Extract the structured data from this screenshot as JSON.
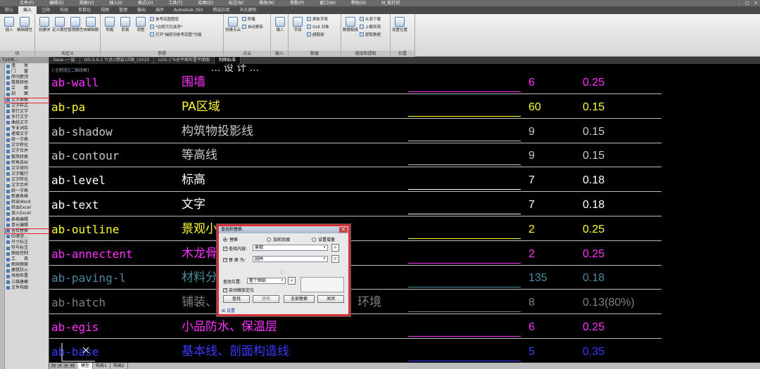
{
  "menubar": {
    "items": [
      "文件(F)",
      "编辑(E)",
      "视图(V)",
      "插入(I)",
      "格式(O)",
      "工具(T)",
      "绘图(D)",
      "标注(N)",
      "修改(M)",
      "参数(P)",
      "窗口(W)",
      "帮助(H)",
      "M_批打印"
    ]
  },
  "ribbon_tabs": {
    "items": [
      "默认",
      "插入",
      "注释",
      "布局",
      "参数化",
      "视图",
      "管理",
      "输出",
      "插件",
      "Autodesk 360",
      "精选应用",
      "天正建筑"
    ],
    "active": "插入"
  },
  "ribbon": {
    "groups": [
      {
        "title": "块",
        "buttons": [
          "插入",
          "编辑属性"
        ]
      },
      {
        "title": "块定义",
        "buttons": [
          "创建块",
          "定义属性",
          "管理属性",
          "块编辑器"
        ]
      },
      {
        "title": "参照",
        "buttons": [
          "附着",
          "剪裁",
          "调整"
        ],
        "small": [
          "参考底图图层",
          "*边框可见选项*",
          "打开\"捕捉到参考底图\"功能"
        ]
      },
      {
        "title": "点云",
        "buttons": [
          "创建点云"
        ],
        "small": [
          "附着",
          "自动更新"
        ]
      },
      {
        "title": "输入",
        "buttons": [
          "输入"
        ]
      },
      {
        "title": "数据",
        "buttons": [
          "字段"
        ],
        "small": [
          "更新字段",
          "OLE 对象",
          "超链接"
        ]
      },
      {
        "title": "链接和提取",
        "buttons": [
          "数据链接"
        ],
        "small": [
          "从源下载",
          "上载到源",
          "提取数据"
        ]
      },
      {
        "title": "位置",
        "buttons": [
          "设置位置"
        ]
      }
    ]
  },
  "sidebar": {
    "header": "T20天...",
    "items": [
      "墙　　体",
      "门　　窗",
      "房间屋顶",
      "楼梯其他",
      "立　　面",
      "剖　　面",
      "文字表格",
      "文字样式",
      "单行文字",
      "多行文字",
      "曲线文字",
      "专业词库",
      "递增文字",
      "统一字高",
      "文字转化",
      "文字合并",
      "繁简转换",
      "转角自纠",
      "文字排列",
      "文字截行",
      "文字转化",
      "文字合并",
      "统一字高",
      "新建表格",
      "转出Word",
      "转出Excel",
      "读入Excel",
      "表格编辑",
      "单元编辑",
      "查找替换",
      "ID类型...",
      "尺寸标注",
      "符号标注",
      "图层控制",
      "工　　具",
      "图块图案",
      "建筑防火",
      "场地布置",
      "三维建模",
      "文件布图"
    ],
    "highlighted": [
      "文字表格",
      "查找替换"
    ]
  },
  "doc_tabs": {
    "items": [
      "base--一层",
      "DG-5.6.1 T(总)(精装)详图_t2010",
      "LOG-1\"6总平面布置平面图",
      "制图标准"
    ],
    "active": "制图标准"
  },
  "canvas": {
    "view_label": "[-][俯视][二维线框]",
    "ghost_heading": "... 设 计 ..."
  },
  "layers": [
    {
      "name": "ab-wall",
      "desc": "围墙",
      "color": "6",
      "lineweight": "0.25",
      "text_color": "#ff33ff"
    },
    {
      "name": "ab-pa",
      "desc": "PA区域",
      "color": "60",
      "lineweight": "0.15",
      "text_color": "#ffff33"
    },
    {
      "name": "ab-shadow",
      "desc": "构筑物投影线",
      "color": "9",
      "lineweight": "0.15",
      "text_color": "#c8c8c8"
    },
    {
      "name": "ab-contour",
      "desc": "等高线",
      "color": "9",
      "lineweight": "0.15",
      "text_color": "#c8c8c8"
    },
    {
      "name": "ab-level",
      "desc": "标高",
      "color": "7",
      "lineweight": "0.18",
      "text_color": "#ffffff"
    },
    {
      "name": "ab-text",
      "desc": "文字",
      "color": "7",
      "lineweight": "0.18",
      "text_color": "#ffffff"
    },
    {
      "name": "ab-outline",
      "desc": "景观小",
      "color": "2",
      "lineweight": "0.25",
      "text_color": "#ffff33"
    },
    {
      "name": "ab-annectent",
      "desc": "木龙骨",
      "color": "2",
      "lineweight": "0.25",
      "text_color": "#ff33ff"
    },
    {
      "name": "ab-paving-l",
      "desc": "材料分",
      "color": "135",
      "lineweight": "0.18",
      "text_color": "#4a8a9e"
    },
    {
      "name": "ab-hatch",
      "desc": "铺装、",
      "desc_tail": "环境",
      "color": "8",
      "lineweight": "0.13(80%)",
      "text_color": "#808080"
    },
    {
      "name": "ab-egis",
      "desc": "小品防水、保温层",
      "color": "6",
      "lineweight": "0.25",
      "text_color": "#ff33ff"
    },
    {
      "name": "ab-base",
      "desc": "基本线、剖面构造线",
      "color": "5",
      "lineweight": "0.35",
      "text_color": "#3a3aff"
    }
  ],
  "layout_tabs": {
    "items": [
      "模型",
      "布局1",
      "布局2"
    ],
    "active": "模型"
  },
  "dialog": {
    "title": "查找和替换",
    "radio_replace": "替换",
    "radio_add_suffix": "加前后缀",
    "radio_spacing": "设置增量",
    "find_label": "查找内容:",
    "find_value": "景观",
    "replace_label": "替 换 为:",
    "replace_value": "园林",
    "scope_label": "查找位置:",
    "scope_value": "整个图纸",
    "auto_zoom_label": "自动缩放定位",
    "btn_find": "查找",
    "btn_replace": "替换",
    "btn_replace_all": "全部替换",
    "btn_close": "关闭",
    "settings_link": "设置"
  }
}
